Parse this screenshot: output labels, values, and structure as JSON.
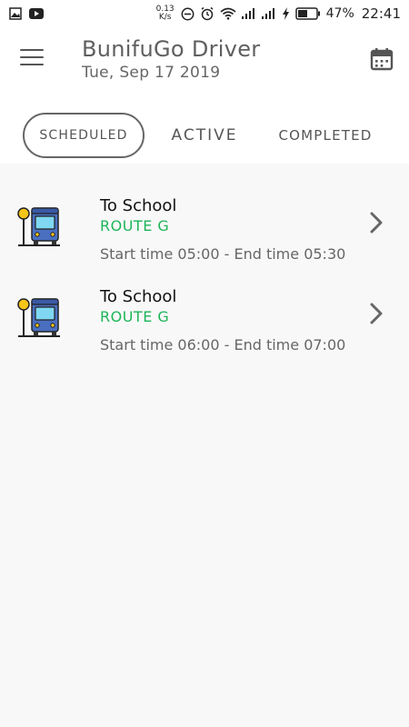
{
  "status_bar": {
    "net_speed_value": "0.13",
    "net_speed_unit": "K/s",
    "battery": "47%",
    "time": "22:41"
  },
  "header": {
    "title": "BunifuGo Driver",
    "date": "Tue, Sep 17 2019"
  },
  "tabs": [
    {
      "label": "SCHEDULED",
      "selected": true
    },
    {
      "label": "ACTIVE",
      "selected": false
    },
    {
      "label": "COMPLETED",
      "selected": false
    }
  ],
  "trips": [
    {
      "title": "To School",
      "route": "ROUTE G",
      "time": "Start time 05:00 - End time 05:30"
    },
    {
      "title": "To School",
      "route": "ROUTE G",
      "time": "Start time 06:00 - End time 07:00"
    }
  ],
  "colors": {
    "route_green": "#1db55a",
    "bus_blue": "#4a6fc0",
    "stop_yellow": "#f5c518"
  }
}
